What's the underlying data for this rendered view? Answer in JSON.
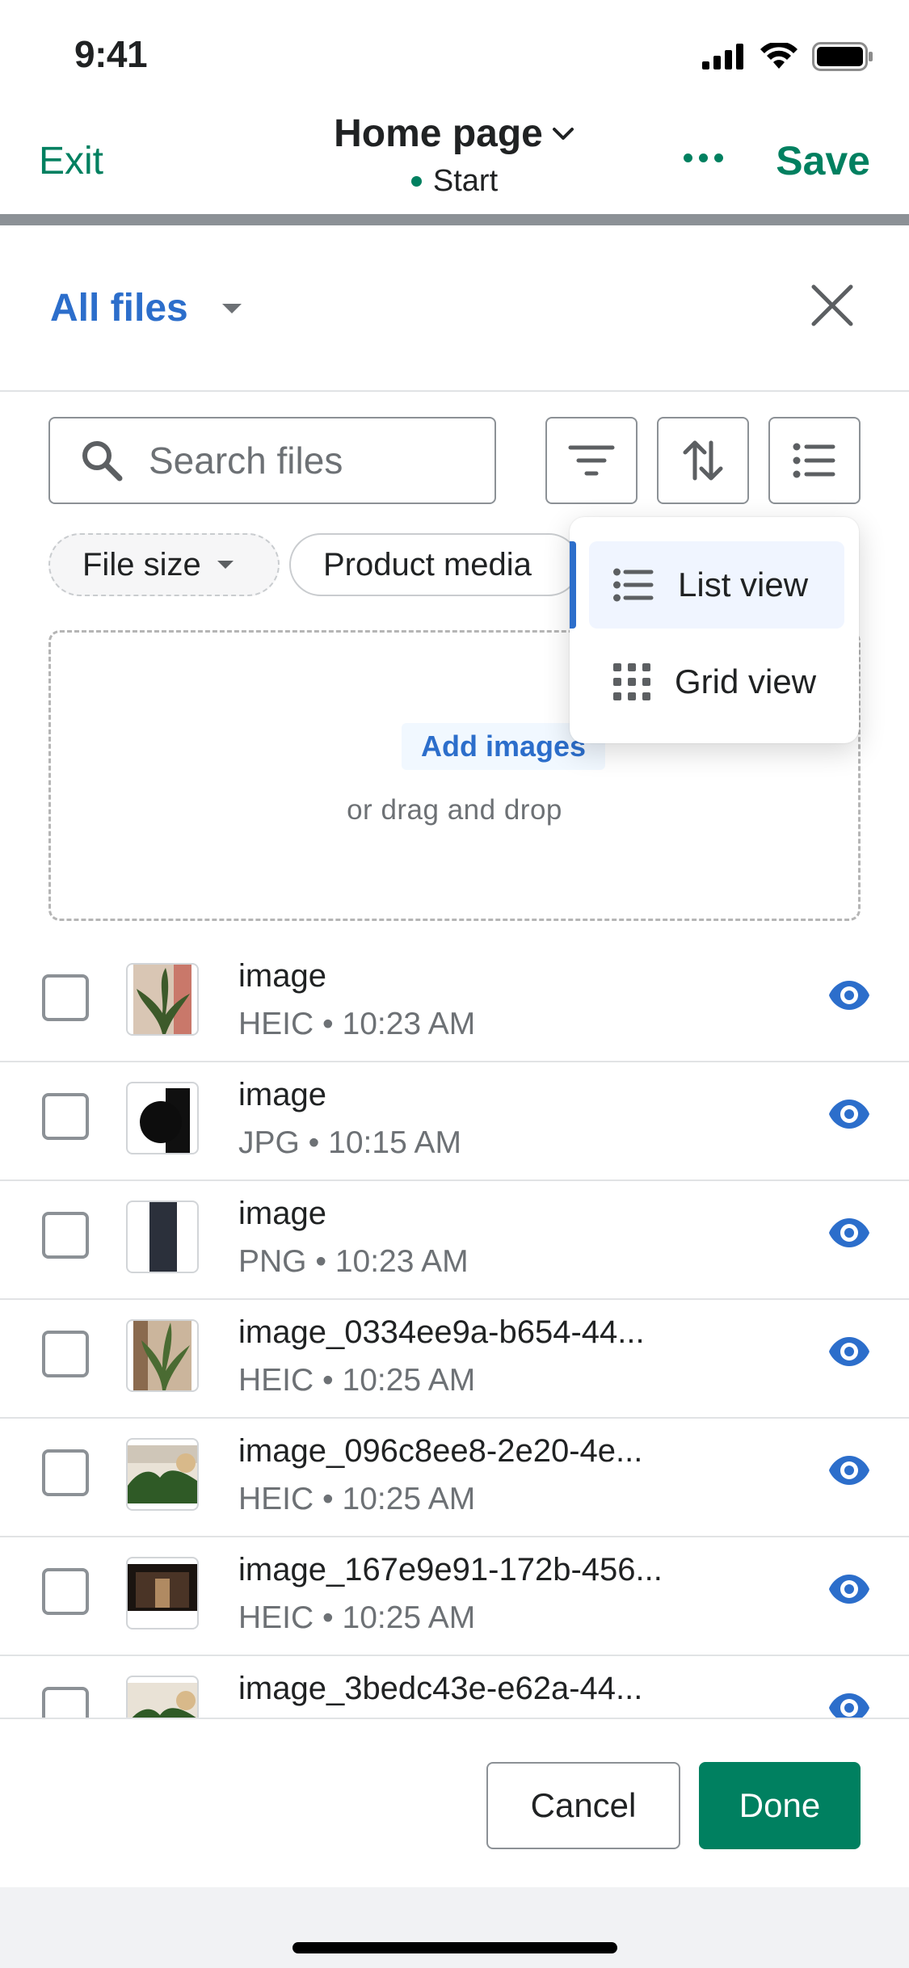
{
  "status_bar": {
    "time": "9:41"
  },
  "editor": {
    "exit_label": "Exit",
    "page_title": "Home page",
    "page_status": "Start",
    "save_label": "Save"
  },
  "sheet": {
    "title": "All files"
  },
  "search": {
    "placeholder": "Search files",
    "value": ""
  },
  "filters": {
    "file_size": "File size",
    "product_media": "Product media"
  },
  "view_menu": {
    "items": [
      {
        "label": "List view",
        "selected": true
      },
      {
        "label": "Grid view",
        "selected": false
      }
    ]
  },
  "dropzone": {
    "add_label": "Add images",
    "hint": "or drag and drop"
  },
  "files": [
    {
      "name": "image",
      "meta": "HEIC • 10:23 AM",
      "thumb": "plant"
    },
    {
      "name": "image",
      "meta": "JPG • 10:15 AM",
      "thumb": "dark-circle"
    },
    {
      "name": "image",
      "meta": "PNG • 10:23 AM",
      "thumb": "dark-bar"
    },
    {
      "name": "image_0334ee9a-b654-44...",
      "meta": "HEIC • 10:25 AM",
      "thumb": "plant"
    },
    {
      "name": "image_096c8ee8-2e20-4e...",
      "meta": "HEIC • 10:25 AM",
      "thumb": "leaves"
    },
    {
      "name": "image_167e9e91-172b-456...",
      "meta": "HEIC • 10:25 AM",
      "thumb": "room"
    },
    {
      "name": "image_3bedc43e-e62a-44...",
      "meta": "",
      "thumb": "leaves"
    }
  ],
  "footer": {
    "cancel_label": "Cancel",
    "done_label": "Done"
  },
  "colors": {
    "accent_green": "#008060",
    "link_blue": "#2c6ecb",
    "border_gray": "#8c9196"
  }
}
